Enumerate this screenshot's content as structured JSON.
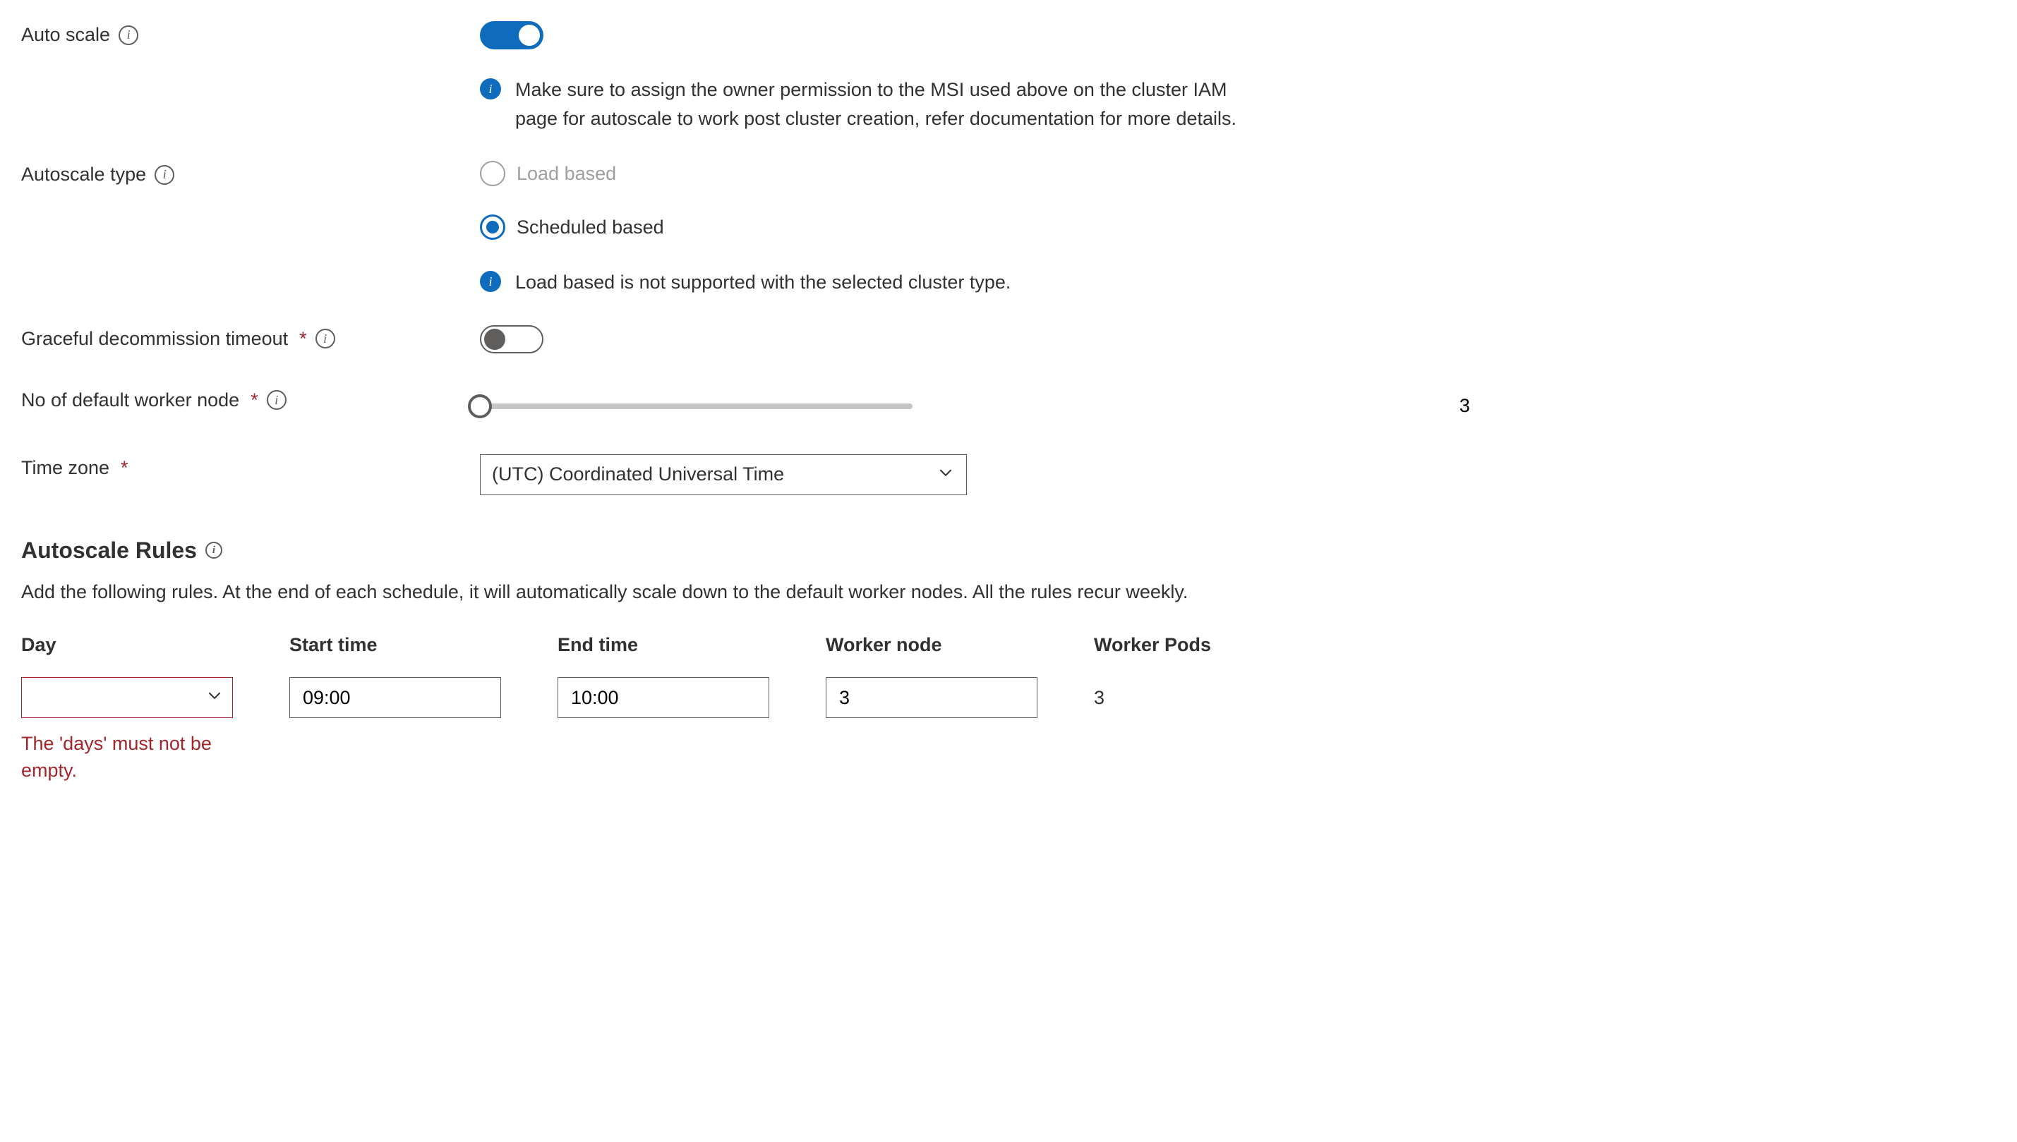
{
  "labels": {
    "auto_scale": "Auto scale",
    "autoscale_type": "Autoscale type",
    "graceful": "Graceful decommission timeout",
    "default_workers": "No of default worker node",
    "timezone": "Time zone"
  },
  "info": {
    "msi": "Make sure to assign the owner permission to the MSI used above on the cluster IAM page for autoscale to work post cluster creation, refer documentation for more details.",
    "load_unsupported": "Load based is not supported with the selected cluster type."
  },
  "autoscale_type": {
    "load": "Load based",
    "scheduled": "Scheduled based"
  },
  "default_workers_value": "3",
  "timezone_value": "(UTC) Coordinated Universal Time",
  "rules": {
    "heading": "Autoscale Rules",
    "desc": "Add the following rules. At the end of each schedule, it will automatically scale down to the default worker nodes. All the rules recur weekly.",
    "cols": {
      "day": "Day",
      "start": "Start time",
      "end": "End time",
      "node": "Worker node",
      "pods": "Worker Pods"
    },
    "row": {
      "day": "",
      "start": "09:00",
      "end": "10:00",
      "node": "3",
      "pods": "3"
    },
    "error": "The 'days' must not be empty."
  }
}
